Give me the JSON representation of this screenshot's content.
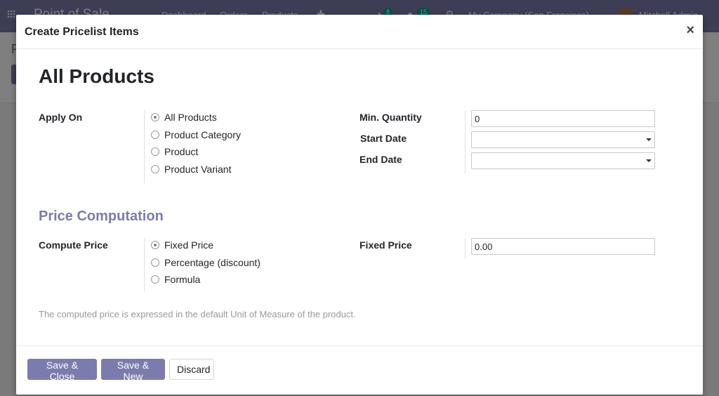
{
  "background": {
    "brand": "Point of Sale",
    "menu": [
      "Dashboard",
      "Orders",
      "Products"
    ],
    "badges": [
      "8",
      "15"
    ],
    "company": "My Company (San Francisco)",
    "user": "Mitchell Admin",
    "breadcrumb": "P"
  },
  "modal": {
    "title": "Create Pricelist Items",
    "close_symbol": "×",
    "heading": "All Products",
    "apply_on": {
      "label": "Apply On",
      "options": [
        "All Products",
        "Product Category",
        "Product",
        "Product Variant"
      ],
      "selected": "All Products"
    },
    "min_quantity": {
      "label": "Min. Quantity",
      "value": "0"
    },
    "start_date": {
      "label": "Start Date",
      "value": ""
    },
    "end_date": {
      "label": "End Date",
      "value": ""
    },
    "price_computation": {
      "title": "Price Computation",
      "label": "Compute Price",
      "options": [
        "Fixed Price",
        "Percentage (discount)",
        "Formula"
      ],
      "selected": "Fixed Price"
    },
    "fixed_price": {
      "label": "Fixed Price",
      "value": "0.00"
    },
    "help_text": "The computed price is expressed in the default Unit of Measure of the product.",
    "buttons": {
      "save_close": "Save & Close",
      "save_new": "Save & New",
      "discard": "Discard"
    }
  },
  "colors": {
    "primary": "#7c7bad",
    "text": "#212529",
    "muted": "#999999"
  }
}
